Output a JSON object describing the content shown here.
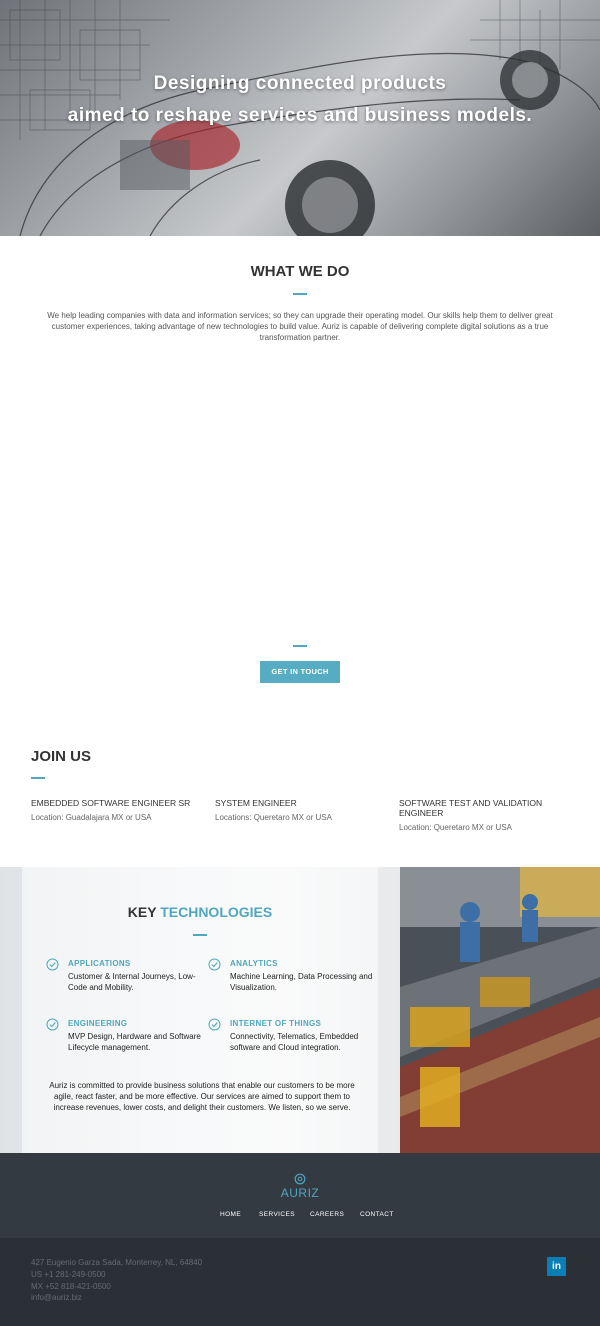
{
  "hero": {
    "line1": "Designing connected products",
    "line2": "aimed to reshape services and business models."
  },
  "what_we_do": {
    "title": "WHAT WE DO",
    "description": "We help leading companies with data and information services; so they can upgrade their operating model. Our skills help them to deliver great customer experiences, taking advantage of new technologies to build value. Auriz is capable of delivering complete digital solutions as a true transformation partner."
  },
  "cta": {
    "label": "GET IN TOUCH"
  },
  "join_us": {
    "title": "JOIN US",
    "jobs": [
      {
        "title": "EMBEDDED SOFTWARE ENGINEER SR",
        "location": "Location: Guadalajara MX or USA"
      },
      {
        "title": "SYSTEM ENGINEER",
        "location": "Locations: Queretaro MX or USA"
      },
      {
        "title": "SOFTWARE TEST AND VALIDATION ENGINEER",
        "location": "Location: Queretaro MX or USA"
      }
    ]
  },
  "key_technologies": {
    "title_prefix": "KEY",
    "title_accent": "TECHNOLOGIES",
    "items": [
      {
        "name": "APPLICATIONS",
        "description": "Customer & Internal Journeys, Low-Code and Mobility."
      },
      {
        "name": "ANALYTICS",
        "description": "Machine Learning, Data Processing and Visualization."
      },
      {
        "name": "ENGINEERING",
        "description": "MVP Design, Hardware and Software Lifecycle management."
      },
      {
        "name": "INTERNET OF THINGS",
        "description": "Connectivity, Telematics, Embedded software and Cloud integration."
      }
    ],
    "summary": "Auriz is committed to provide business solutions that enable our customers to be more agile, react faster, and be more effective. Our services are aimed to support them to increase revenues, lower costs, and delight their customers. We listen, so we serve."
  },
  "footer": {
    "brand": "AURIZ",
    "nav": [
      "HOME",
      "SERVICES",
      "CAREERS",
      "CONTACT"
    ],
    "address": "427 Eugenio Garza Sada, Monterrey, NL, 64840",
    "phone_us": "US +1 281-249-0500",
    "phone_mx": "MX +52 818-421-0500",
    "email": "info@auriz.biz",
    "social": "in"
  },
  "colors": {
    "accent": "#4fa7be",
    "button": "#56adc3",
    "footer_top": "#343a42",
    "footer_bottom": "#2b3037",
    "linkedin": "#0a7fb6"
  }
}
